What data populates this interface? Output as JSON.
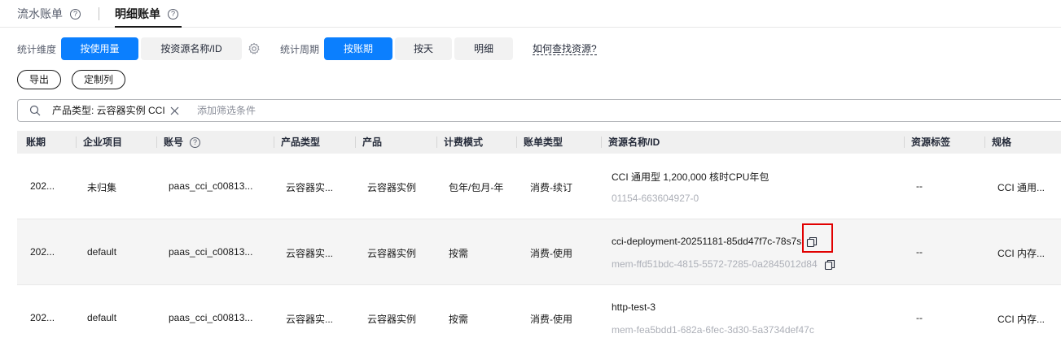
{
  "tabs": [
    {
      "label": "流水账单",
      "active": false
    },
    {
      "label": "明细账单",
      "active": true
    }
  ],
  "help_glyph": "?",
  "filters": {
    "dimension_label": "统计维度",
    "dimension_options": [
      "按使用量",
      "按资源名称/ID"
    ],
    "dimension_selected": "按使用量",
    "period_label": "统计周期",
    "period_options": [
      "按账期",
      "按天",
      "明细"
    ],
    "period_selected": "按账期",
    "find_resource_link": "如何查找资源?"
  },
  "actions": {
    "export_label": "导出",
    "customize_columns_label": "定制列"
  },
  "search": {
    "chip_label": "产品类型: 云容器实例 CCI",
    "placeholder": "添加筛选条件"
  },
  "table": {
    "columns": [
      "账期",
      "企业项目",
      "账号",
      "产品类型",
      "产品",
      "计费模式",
      "账单类型",
      "资源名称/ID",
      "资源标签",
      "规格"
    ],
    "rows": [
      {
        "period": "202...",
        "enterprise_project": "未归集",
        "account": "paas_cci_c00813...",
        "product_type": "云容器实...",
        "product": "云容器实例",
        "billing_mode": "包年/包月-年",
        "bill_type": "消费-续订",
        "resource_name": "CCI 通用型 1,200,000 核时CPU年包",
        "resource_id": "01154-663604927-0",
        "tags": "--",
        "spec": "CCI 通用..."
      },
      {
        "period": "202...",
        "enterprise_project": "default",
        "account": "paas_cci_c00813...",
        "product_type": "云容器实...",
        "product": "云容器实例",
        "billing_mode": "按需",
        "bill_type": "消费-使用",
        "resource_name": "cci-deployment-20251181-85dd47f7c-78s7s",
        "resource_id": "mem-ffd51bdc-4815-5572-7285-0a2845012d84",
        "tags": "--",
        "spec": "CCI 内存..."
      },
      {
        "period": "202...",
        "enterprise_project": "default",
        "account": "paas_cci_c00813...",
        "product_type": "云容器实...",
        "product": "云容器实例",
        "billing_mode": "按需",
        "bill_type": "消费-使用",
        "resource_name": "http-test-3",
        "resource_id": "mem-fea5bdd1-682a-6fec-3d30-5a3734def47c",
        "tags": "--",
        "spec": "CCI 内存..."
      }
    ]
  },
  "colors": {
    "accent": "#0b7ffe",
    "highlight": "#e10000"
  },
  "icons": [
    "help-icon",
    "gear-icon",
    "search-icon",
    "close-icon",
    "copy-icon"
  ]
}
